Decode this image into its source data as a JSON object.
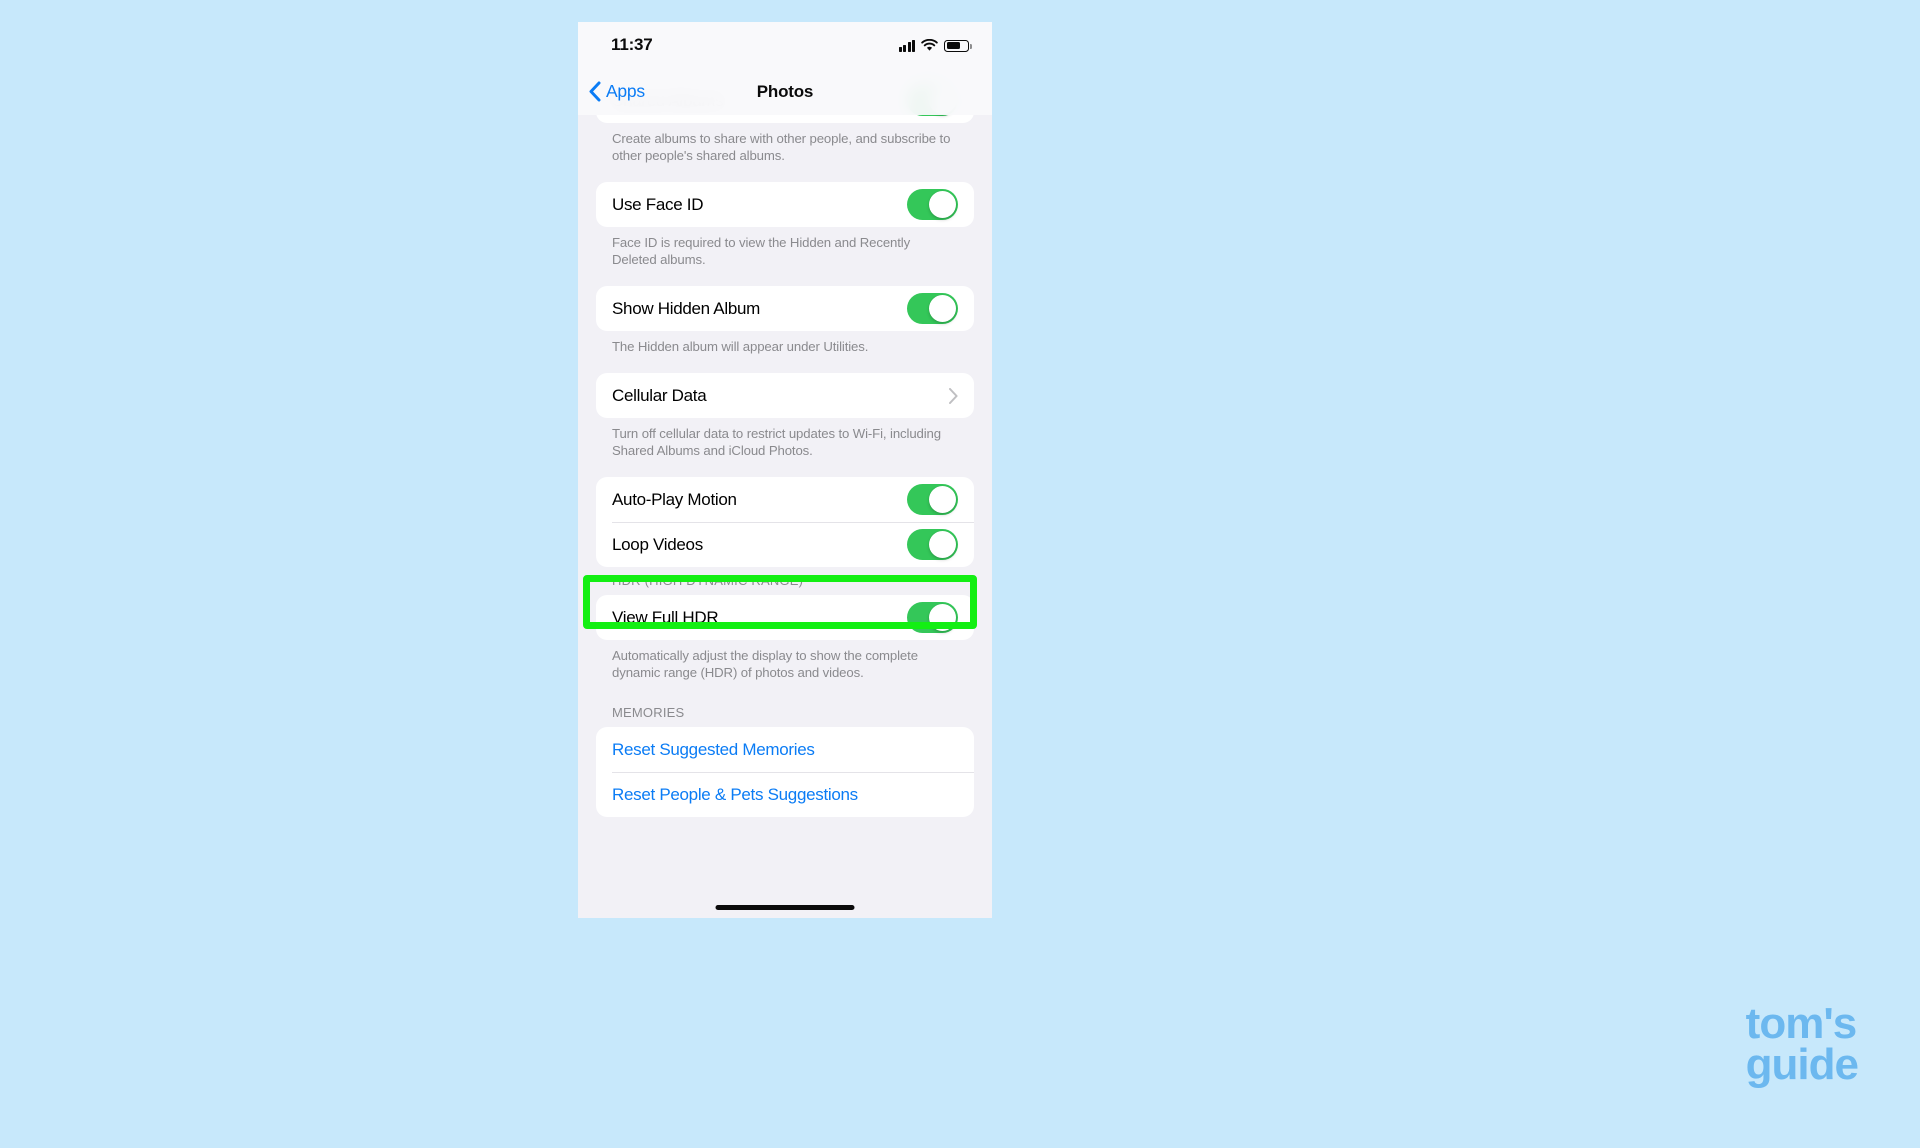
{
  "page": {
    "background_color": "#c7e8fb",
    "highlight_color": "#13ef13",
    "accent_blue": "#0b7cf5",
    "toggle_green": "#34c759"
  },
  "status_bar": {
    "time": "11:37",
    "cellular_icon": "cellular-bars-icon",
    "wifi_icon": "wifi-icon",
    "battery_icon": "battery-icon"
  },
  "nav_bar": {
    "back_label": "Apps",
    "back_icon": "chevron-left-icon",
    "title": "Photos"
  },
  "settings": {
    "partial_row": {
      "label": "Shared Albums",
      "toggle": "on"
    },
    "groups": [
      {
        "footnote": "Create albums to share with other people, and subscribe to other people's shared albums."
      },
      {
        "rows": [
          {
            "label": "Use Face ID",
            "control": "toggle",
            "toggle": "on"
          }
        ],
        "footnote": "Face ID is required to view the Hidden and Recently Deleted albums."
      },
      {
        "rows": [
          {
            "label": "Show Hidden Album",
            "control": "toggle",
            "toggle": "on"
          }
        ],
        "footnote": "The Hidden album will appear under Utilities."
      },
      {
        "rows": [
          {
            "label": "Cellular Data",
            "control": "chevron"
          }
        ],
        "footnote": "Turn off cellular data to restrict updates to Wi-Fi, including Shared Albums and iCloud Photos."
      },
      {
        "rows": [
          {
            "label": "Auto-Play Motion",
            "control": "toggle",
            "toggle": "on"
          },
          {
            "label": "Loop Videos",
            "control": "toggle",
            "toggle": "on",
            "highlighted": true
          }
        ]
      },
      {
        "header": "HDR (HIGH DYNAMIC RANGE)",
        "rows": [
          {
            "label": "View Full HDR",
            "control": "toggle",
            "toggle": "on"
          }
        ],
        "footnote": "Automatically adjust the display to show the complete dynamic range (HDR) of photos and videos."
      },
      {
        "header": "MEMORIES",
        "rows": [
          {
            "label": "Reset Suggested Memories",
            "control": "link"
          },
          {
            "label": "Reset People & Pets Suggestions",
            "control": "link"
          }
        ]
      }
    ]
  },
  "watermark": {
    "line1": "tom's",
    "line2": "guide"
  }
}
